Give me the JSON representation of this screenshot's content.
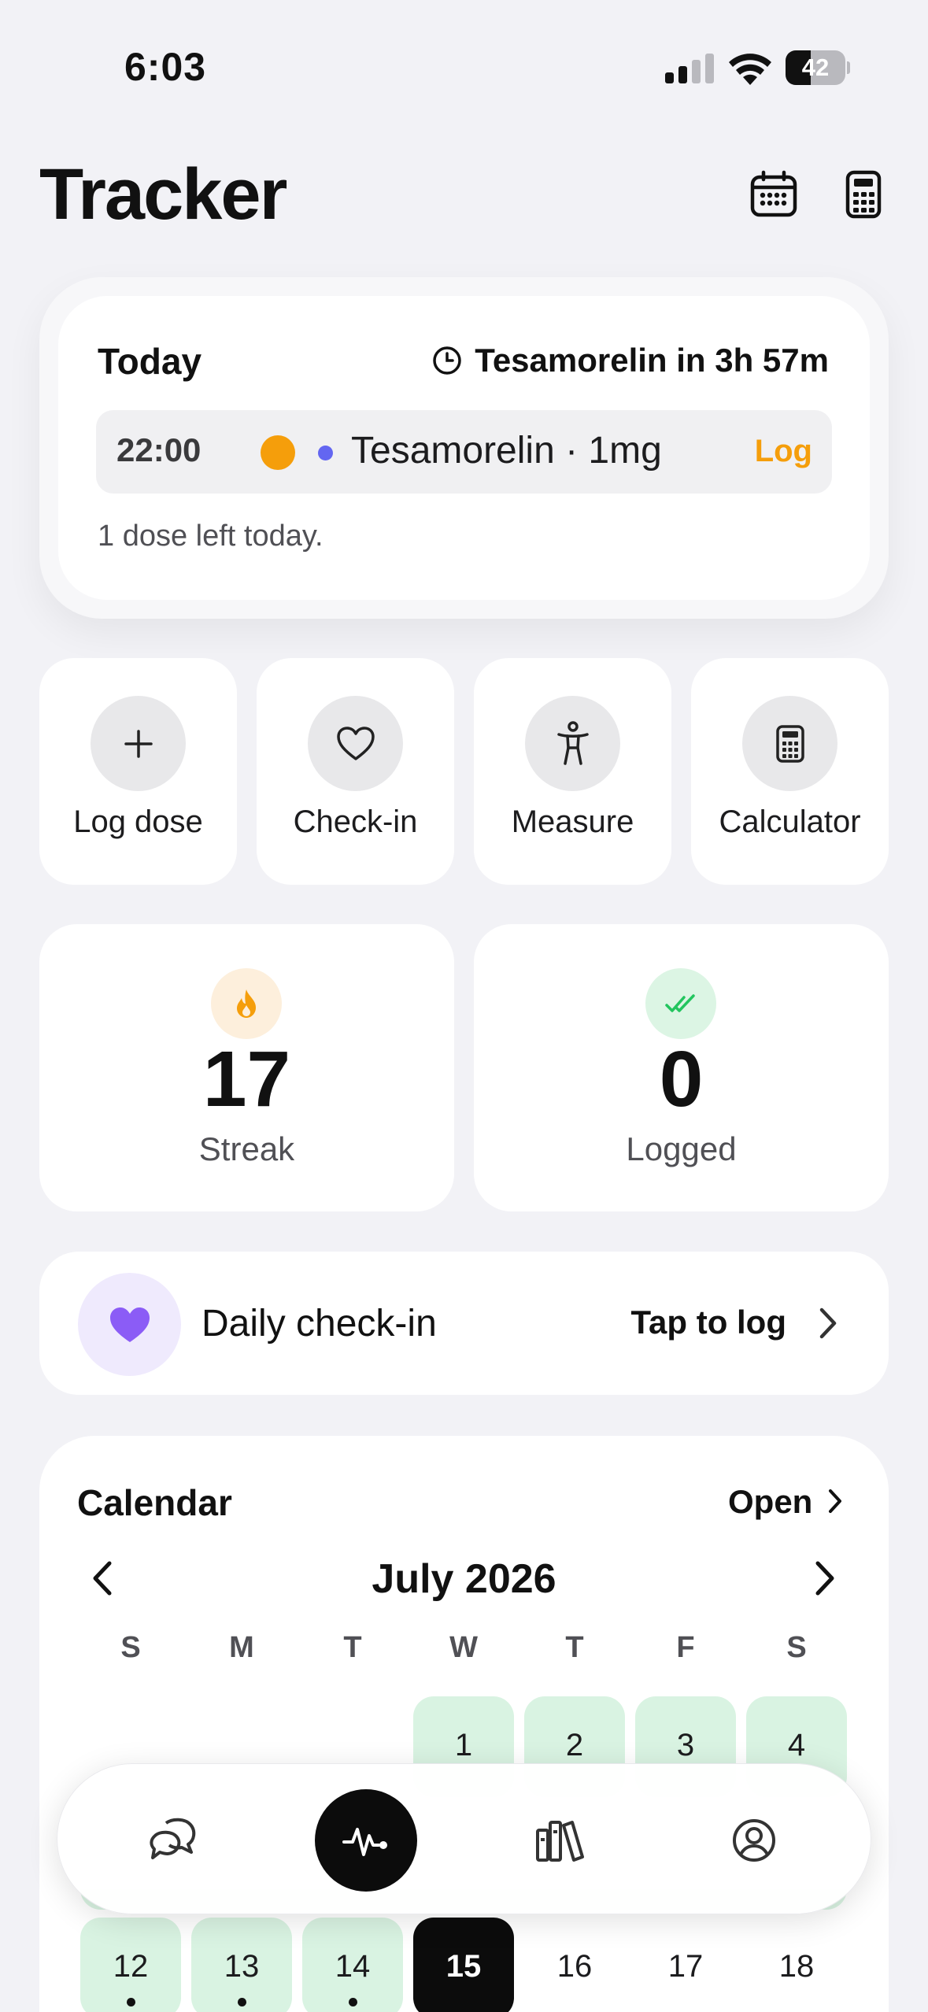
{
  "status_bar": {
    "time": "6:03",
    "battery": "42",
    "battery_level": 0.42
  },
  "header": {
    "title": "Tracker",
    "calendar_icon": "calendar-icon",
    "calculator_icon": "calculator-icon"
  },
  "today_card": {
    "title": "Today",
    "countdown": "Tesamorelin in 3h 57m",
    "dose": {
      "time": "22:00",
      "name": "Tesamorelin · 1mg",
      "action": "Log",
      "primary_color": "#f59e0b",
      "secondary_color": "#6366f1"
    },
    "remaining": "1 dose left today."
  },
  "quick_actions": [
    {
      "label": "Log dose",
      "icon": "plus-icon"
    },
    {
      "label": "Check-in",
      "icon": "heart-icon"
    },
    {
      "label": "Measure",
      "icon": "body-icon"
    },
    {
      "label": "Calculator",
      "icon": "calculator-icon"
    }
  ],
  "stats": {
    "streak": {
      "value": "17",
      "label": "Streak",
      "icon": "flame-icon",
      "color": "#f59e0b"
    },
    "logged": {
      "value": "0",
      "label": "Logged",
      "icon": "double-check-icon",
      "color": "#22c55e"
    }
  },
  "daily_checkin": {
    "label": "Daily check-in",
    "cta": "Tap to log",
    "icon": "heart-icon",
    "color": "#8b5cf6"
  },
  "calendar": {
    "title": "Calendar",
    "open_label": "Open",
    "month": "July 2026",
    "weekdays": [
      "S",
      "M",
      "T",
      "W",
      "T",
      "F",
      "S"
    ],
    "week1": [
      {
        "day": "1",
        "logged": true
      },
      {
        "day": "2",
        "logged": true
      },
      {
        "day": "3",
        "logged": true
      },
      {
        "day": "4",
        "logged": true
      }
    ],
    "week_visible": [
      {
        "day": "12",
        "logged": true,
        "dot": true
      },
      {
        "day": "13",
        "logged": true,
        "dot": true
      },
      {
        "day": "14",
        "logged": true,
        "dot": true
      },
      {
        "day": "15",
        "today": true
      },
      {
        "day": "16"
      },
      {
        "day": "17"
      },
      {
        "day": "18"
      }
    ]
  },
  "tab_bar": {
    "tabs": [
      {
        "name": "chat",
        "icon": "chat-bubbles-icon",
        "active": false
      },
      {
        "name": "tracker",
        "icon": "pulse-icon",
        "active": true
      },
      {
        "name": "library",
        "icon": "library-icon",
        "active": false
      },
      {
        "name": "profile",
        "icon": "profile-icon",
        "active": false
      }
    ]
  }
}
